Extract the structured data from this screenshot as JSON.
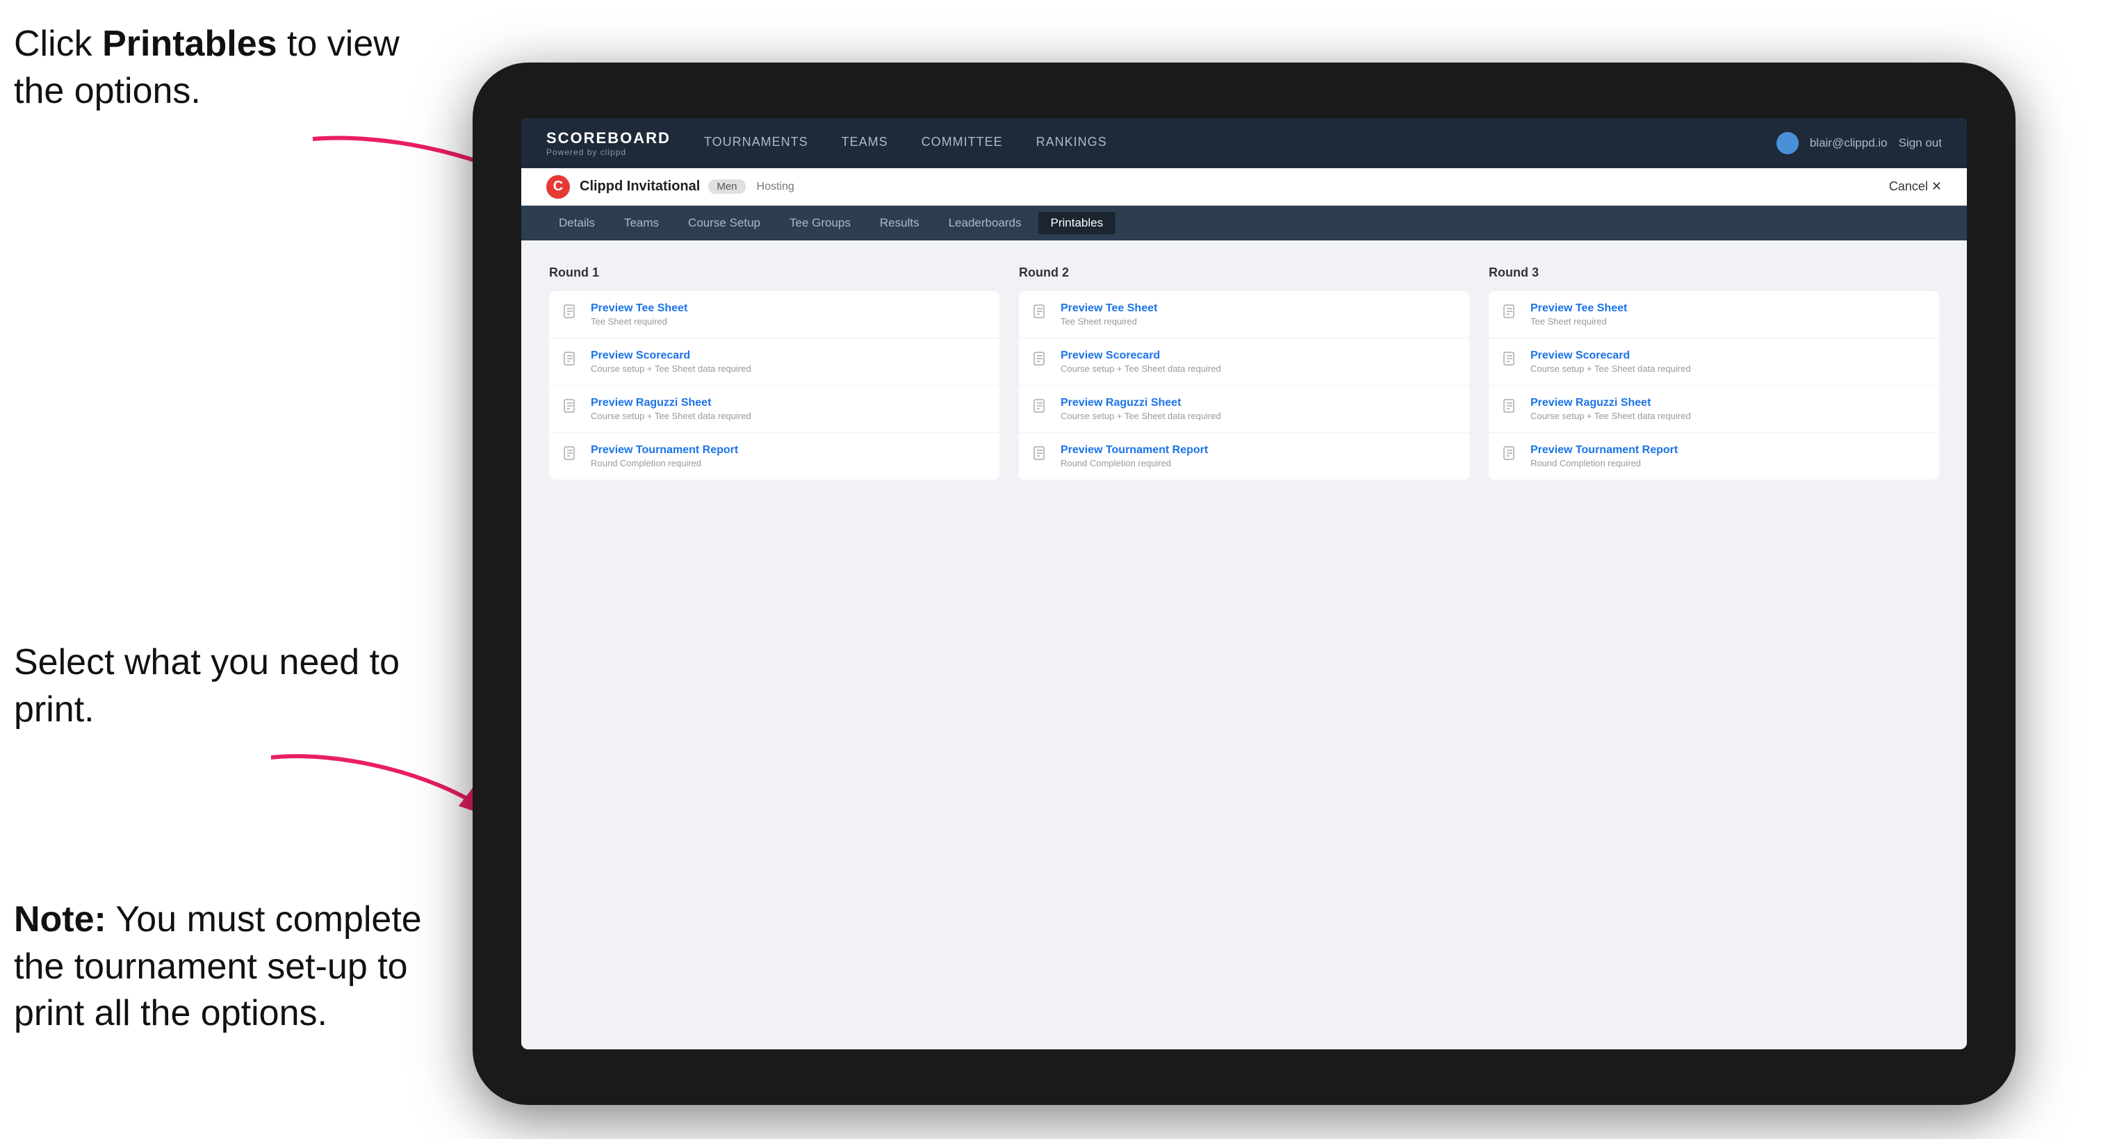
{
  "annotations": {
    "top": {
      "text_before": "Click ",
      "bold": "Printables",
      "text_after": " to view the options."
    },
    "middle": {
      "text": "Select what you need to print."
    },
    "bottom": {
      "bold": "Note:",
      "text": " You must complete the tournament set-up to print all the options."
    }
  },
  "topnav": {
    "logo_title": "SCOREBOARD",
    "logo_sub": "Powered by clippd",
    "links": [
      {
        "label": "TOURNAMENTS",
        "active": false
      },
      {
        "label": "TEAMS",
        "active": false
      },
      {
        "label": "COMMITTEE",
        "active": false
      },
      {
        "label": "RANKINGS",
        "active": false
      }
    ],
    "user_email": "blair@clippd.io",
    "sign_out": "Sign out"
  },
  "tournament": {
    "logo_letter": "C",
    "name": "Clippd Invitational",
    "badge": "Men",
    "status": "Hosting",
    "cancel_label": "Cancel ✕"
  },
  "subtabs": {
    "tabs": [
      {
        "label": "Details",
        "active": false
      },
      {
        "label": "Teams",
        "active": false
      },
      {
        "label": "Course Setup",
        "active": false
      },
      {
        "label": "Tee Groups",
        "active": false
      },
      {
        "label": "Results",
        "active": false
      },
      {
        "label": "Leaderboards",
        "active": false
      },
      {
        "label": "Printables",
        "active": true
      }
    ]
  },
  "rounds": [
    {
      "title": "Round 1",
      "items": [
        {
          "title": "Preview Tee Sheet",
          "sub": "Tee Sheet required"
        },
        {
          "title": "Preview Scorecard",
          "sub": "Course setup + Tee Sheet data required"
        },
        {
          "title": "Preview Raguzzi Sheet",
          "sub": "Course setup + Tee Sheet data required"
        },
        {
          "title": "Preview Tournament Report",
          "sub": "Round Completion required"
        }
      ]
    },
    {
      "title": "Round 2",
      "items": [
        {
          "title": "Preview Tee Sheet",
          "sub": "Tee Sheet required"
        },
        {
          "title": "Preview Scorecard",
          "sub": "Course setup + Tee Sheet data required"
        },
        {
          "title": "Preview Raguzzi Sheet",
          "sub": "Course setup + Tee Sheet data required"
        },
        {
          "title": "Preview Tournament Report",
          "sub": "Round Completion required"
        }
      ]
    },
    {
      "title": "Round 3",
      "items": [
        {
          "title": "Preview Tee Sheet",
          "sub": "Tee Sheet required"
        },
        {
          "title": "Preview Scorecard",
          "sub": "Course setup + Tee Sheet data required"
        },
        {
          "title": "Preview Raguzzi Sheet",
          "sub": "Course setup + Tee Sheet data required"
        },
        {
          "title": "Preview Tournament Report",
          "sub": "Round Completion required"
        }
      ]
    }
  ]
}
